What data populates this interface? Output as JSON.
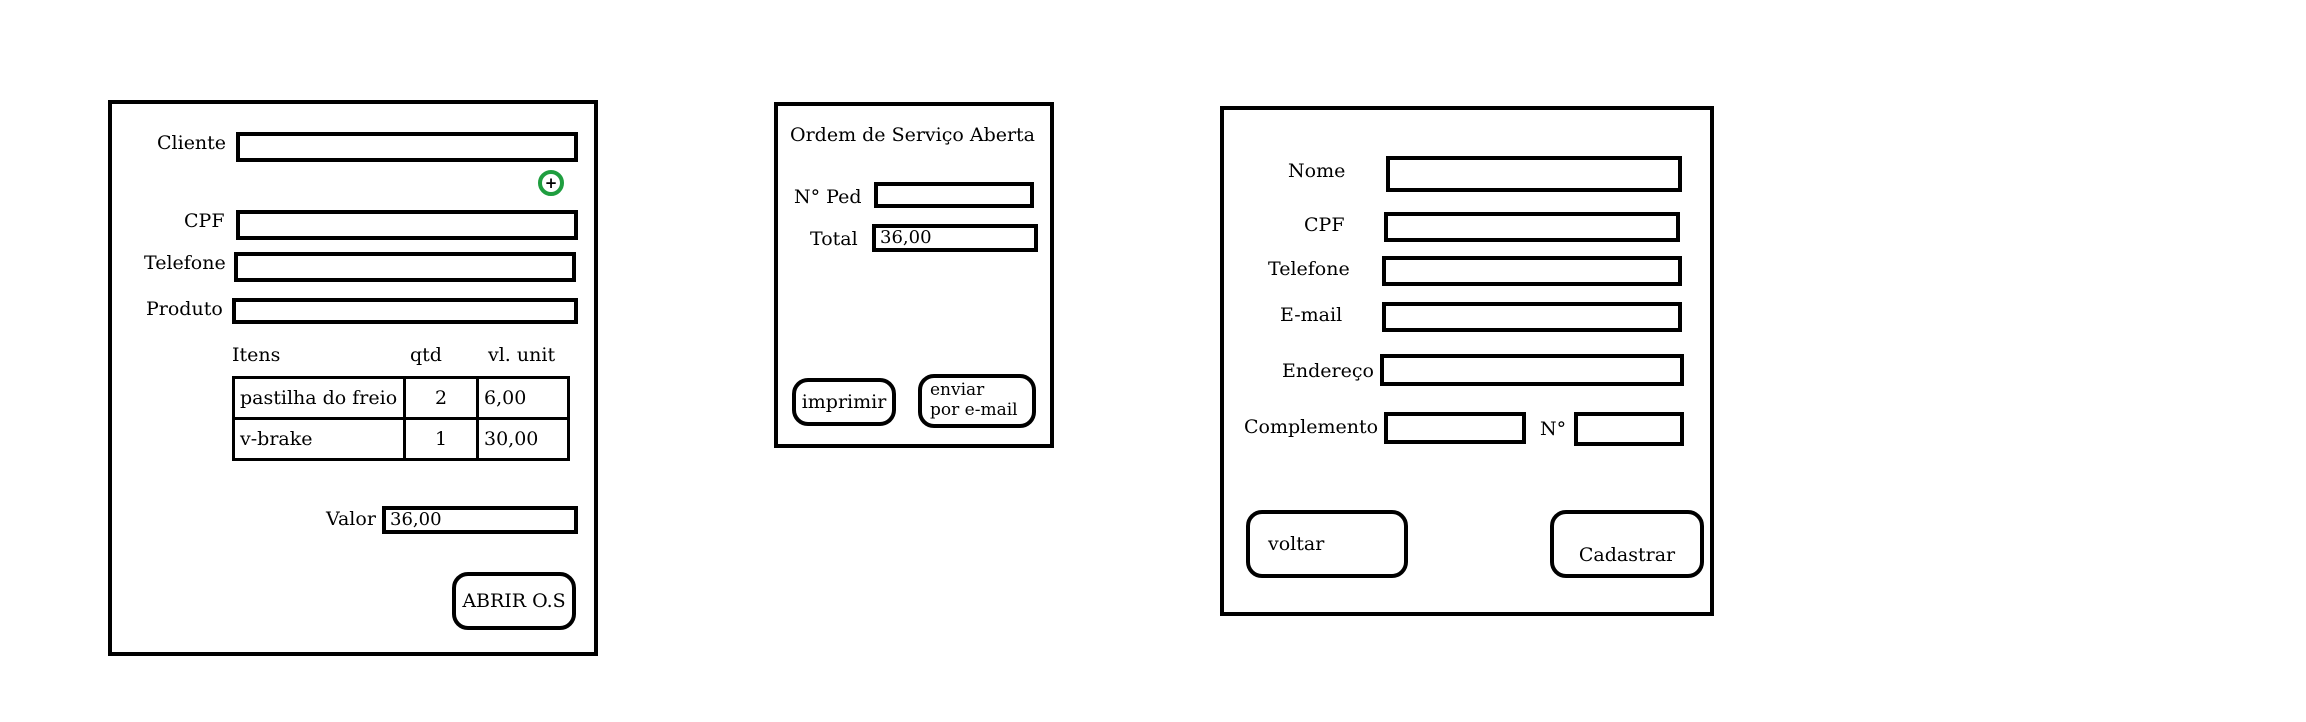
{
  "os_form": {
    "cliente_label": "Cliente",
    "cpf_label": "CPF",
    "telefone_label": "Telefone",
    "produto_label": "Produto",
    "items_headers": [
      "Itens",
      "qtd",
      "vl. unit"
    ],
    "items": [
      {
        "name": "pastilha do freio",
        "qtd": "2",
        "unit": "6,00"
      },
      {
        "name": "v-brake",
        "qtd": "1",
        "unit": "30,00"
      }
    ],
    "valor_label": "Valor",
    "valor_value": "36,00",
    "abrir_label": "ABRIR O.S",
    "add_icon": "plus-circle-icon",
    "add_icon_color": "#1f9e3f"
  },
  "summary": {
    "title": "Ordem de Serviço Aberta",
    "ped_label": "N° Ped",
    "ped_value": "",
    "total_label": "Total",
    "total_value": "36,00",
    "imprimir_label": "imprimir",
    "enviar_line1": "enviar",
    "enviar_line2": "por e-mail"
  },
  "cadastro": {
    "nome_label": "Nome",
    "cpf_label": "CPF",
    "telefone_label": "Telefone",
    "email_label": "E-mail",
    "endereco_label": "Endereço",
    "complemento_label": "Complemento",
    "numero_label": "N°",
    "voltar_label": "voltar",
    "cadastrar_label": "Cadastrar"
  }
}
